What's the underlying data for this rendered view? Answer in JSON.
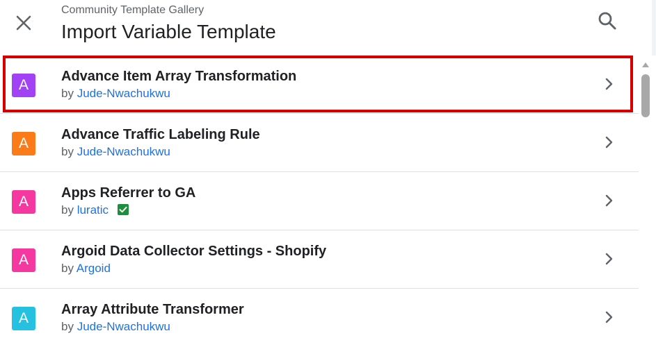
{
  "header": {
    "subtitle": "Community Template Gallery",
    "title": "Import Variable Template",
    "close_icon": "close-icon",
    "search_icon": "search-icon"
  },
  "templates": [
    {
      "avatar_letter": "A",
      "avatar_color": "#a142f4",
      "name": "Advance Item Array Transformation",
      "by": "by",
      "author": "Jude-Nwachukwu",
      "verified": false,
      "selected": true
    },
    {
      "avatar_letter": "A",
      "avatar_color": "#fa7b17",
      "name": "Advance Traffic Labeling Rule",
      "by": "by",
      "author": "Jude-Nwachukwu",
      "verified": false,
      "selected": false
    },
    {
      "avatar_letter": "A",
      "avatar_color": "#f538a0",
      "name": "Apps Referrer to GA",
      "by": "by",
      "author": "luratic",
      "verified": true,
      "selected": false
    },
    {
      "avatar_letter": "A",
      "avatar_color": "#f538a0",
      "name": "Argoid Data Collector Settings - Shopify",
      "by": "by",
      "author": "Argoid",
      "verified": false,
      "selected": false
    },
    {
      "avatar_letter": "A",
      "avatar_color": "#24c1e0",
      "name": "Array Attribute Transformer",
      "by": "by",
      "author": "Jude-Nwachukwu",
      "verified": false,
      "selected": false
    }
  ],
  "colors": {
    "link": "#1a73e8",
    "highlight_border": "#d60000",
    "verified_badge": "#1e8e3e"
  }
}
